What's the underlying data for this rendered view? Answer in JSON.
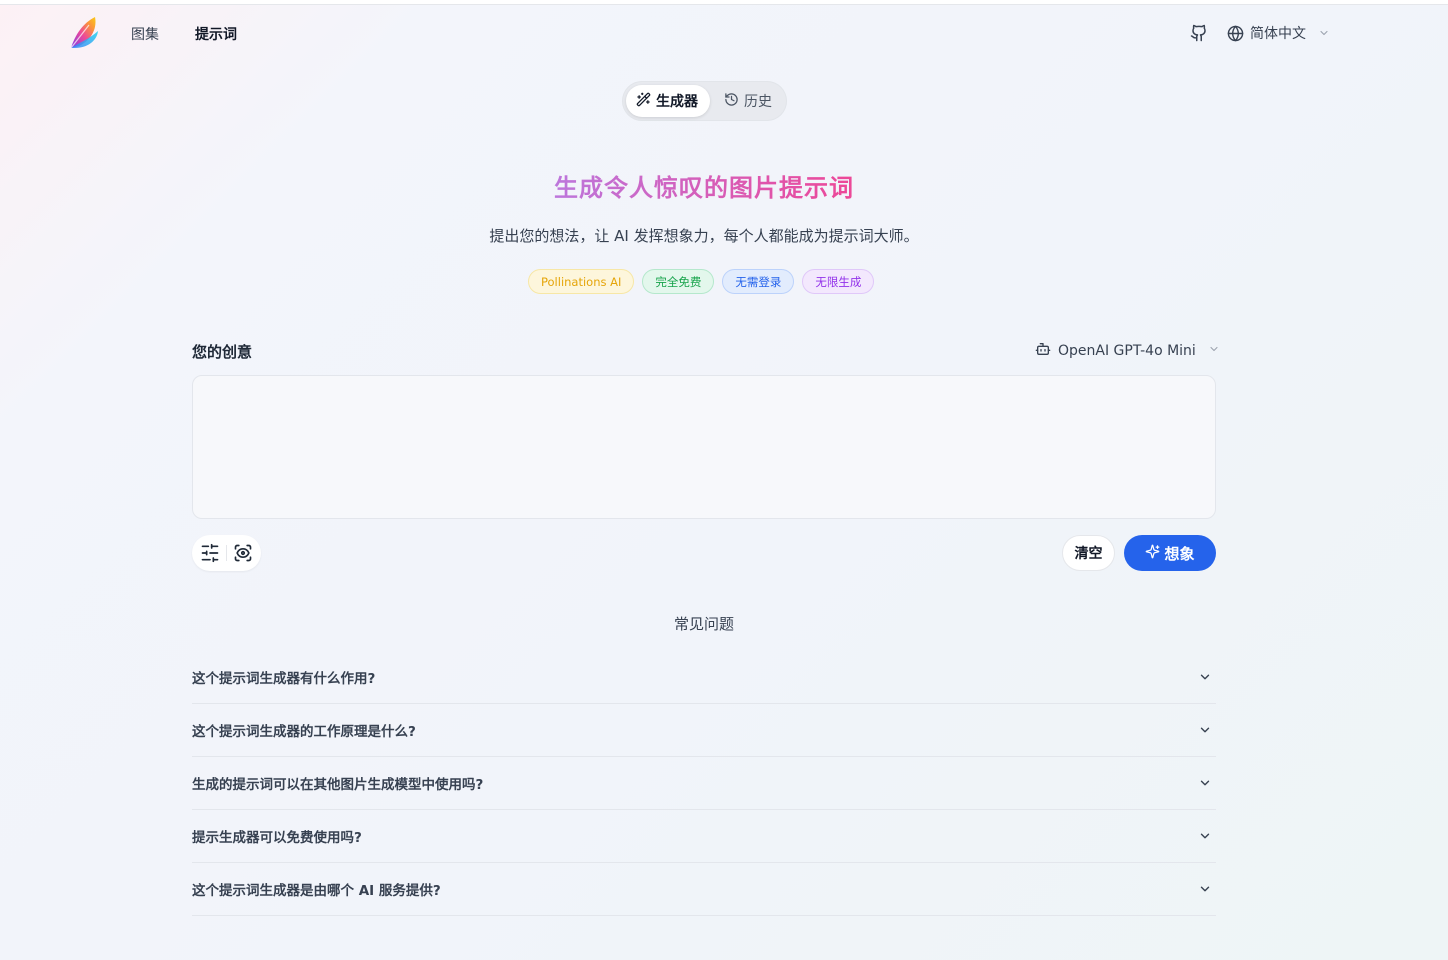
{
  "header": {
    "nav": [
      {
        "label": "图集",
        "active": false
      },
      {
        "label": "提示词",
        "active": true
      }
    ],
    "language": "简体中文"
  },
  "tabs": {
    "generator": "生成器",
    "history": "历史"
  },
  "hero": {
    "title": "生成令人惊叹的图片提示词",
    "subtitle": "提出您的想法，让 AI 发挥想象力，每个人都能成为提示词大师。",
    "badges": [
      "Pollinations AI",
      "完全免费",
      "无需登录",
      "无限生成"
    ]
  },
  "input": {
    "label": "您的创意",
    "model": "OpenAI GPT-4o Mini",
    "value": "",
    "placeholder": ""
  },
  "actions": {
    "clear": "清空",
    "imagine": "想象"
  },
  "faq": {
    "title": "常见问题",
    "items": [
      "这个提示词生成器有什么作用?",
      "这个提示词生成器的工作原理是什么?",
      "生成的提示词可以在其他图片生成模型中使用吗?",
      "提示生成器可以免费使用吗?",
      "这个提示词生成器是由哪个 AI 服务提供?"
    ]
  },
  "colors": {
    "primary": "#2563eb",
    "title_gradient": [
      "#60a5fa",
      "#a78bfa",
      "#ec4899",
      "#fb923c"
    ]
  }
}
